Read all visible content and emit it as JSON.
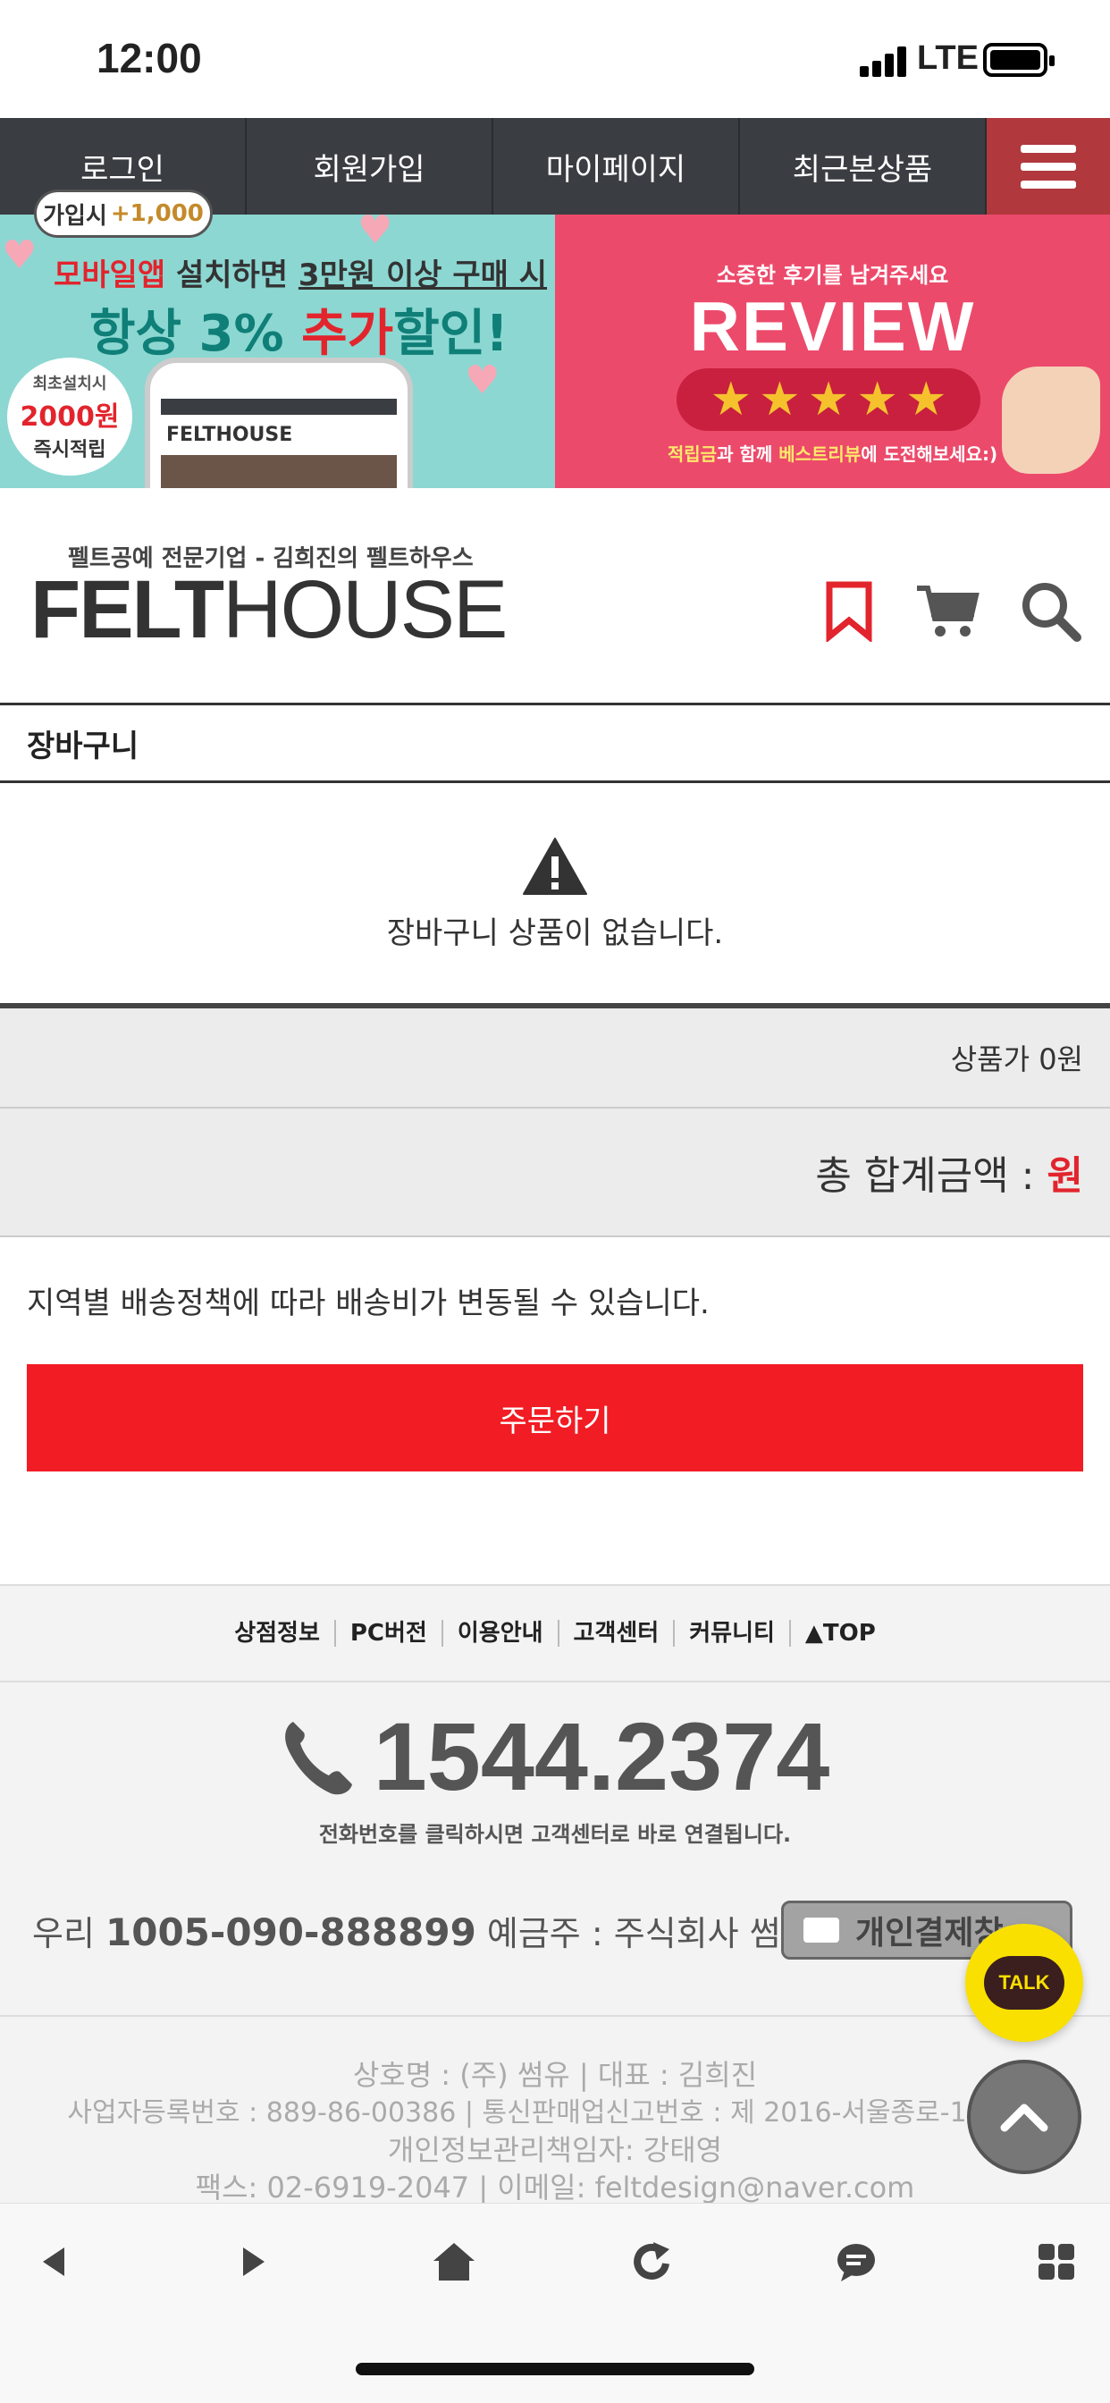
{
  "status_bar": {
    "time": "12:00",
    "network": "LTE"
  },
  "top_nav": {
    "items": [
      "로그인",
      "회원가입",
      "마이페이지",
      "최근본상품"
    ]
  },
  "banner_left": {
    "badge_prefix": "가입시",
    "badge_points": "+1,000",
    "line1_red": "모바일앱",
    "line1_mid": " 설치하면 ",
    "line1_ul": "3만원 이상 구매 시",
    "line2_a": "항상 3% ",
    "line2_red": "추가",
    "line2_b": "할인!",
    "bubble_small": "최초설치시",
    "bubble_amount": "2000원",
    "bubble_bottom": "즉시적립",
    "phone_logo": "FELTHOUSE"
  },
  "banner_right": {
    "line1": "소중한 후기를 남겨주세요",
    "title": "REVIEW",
    "line3_a": "적립금",
    "line3_b": "과 함께 ",
    "line3_c": "베스트리뷰",
    "line3_d": "에 도전해보세요:)"
  },
  "brand": {
    "tagline": "펠트공예 전문기업 - 김희진의 펠트하우스",
    "logo_bold": "FELT",
    "logo_thin": "HOUSE"
  },
  "cart": {
    "title": "장바구니",
    "empty_message": "장바구니 상품이 없습니다.",
    "subtotal": "상품가 0원",
    "total_label": "총 합계금액 :",
    "total_unit": "원",
    "shipping_note": "지역별 배송정책에 따라 배송비가 변동될 수 있습니다.",
    "order_button": "주문하기"
  },
  "footer": {
    "links": [
      "상점정보",
      "PC버전",
      "이용안내",
      "고객센터",
      "커뮤니티",
      "▲TOP"
    ],
    "phone": "1544.2374",
    "phone_hint": "전화번호를 클릭하시면 고객센터로 바로 연결됩니다.",
    "bank_prefix": "우리",
    "bank_account": "1005-090-888899",
    "bank_holder": "예금주 : 주식회사 썸유",
    "pay_button": "개인결제창",
    "info_lines": [
      "상호명 : (주) 썸유   |   대표 : 김희진",
      "사업자등록번호 : 889-86-00386  |  통신판매업신고번호 : 제 2016-서울종로-1016호",
      "개인정보관리책임자: 강태영",
      "팩스: 02-6919-2047  |  이메일: feltdesign@naver.com"
    ],
    "talk_label": "TALK"
  },
  "colors": {
    "nav_bg": "#3a3d42",
    "menu_bg": "#b1383d",
    "order_red": "#f21c24",
    "total_red": "#e2242d",
    "talk_yellow": "#f9e000"
  },
  "icons": [
    "bookmark-icon",
    "cart-icon",
    "search-icon",
    "warning-icon",
    "phone-icon",
    "chevron-up-icon",
    "back-icon",
    "forward-icon",
    "home-icon",
    "refresh-icon",
    "chat-icon",
    "grid-icon"
  ]
}
